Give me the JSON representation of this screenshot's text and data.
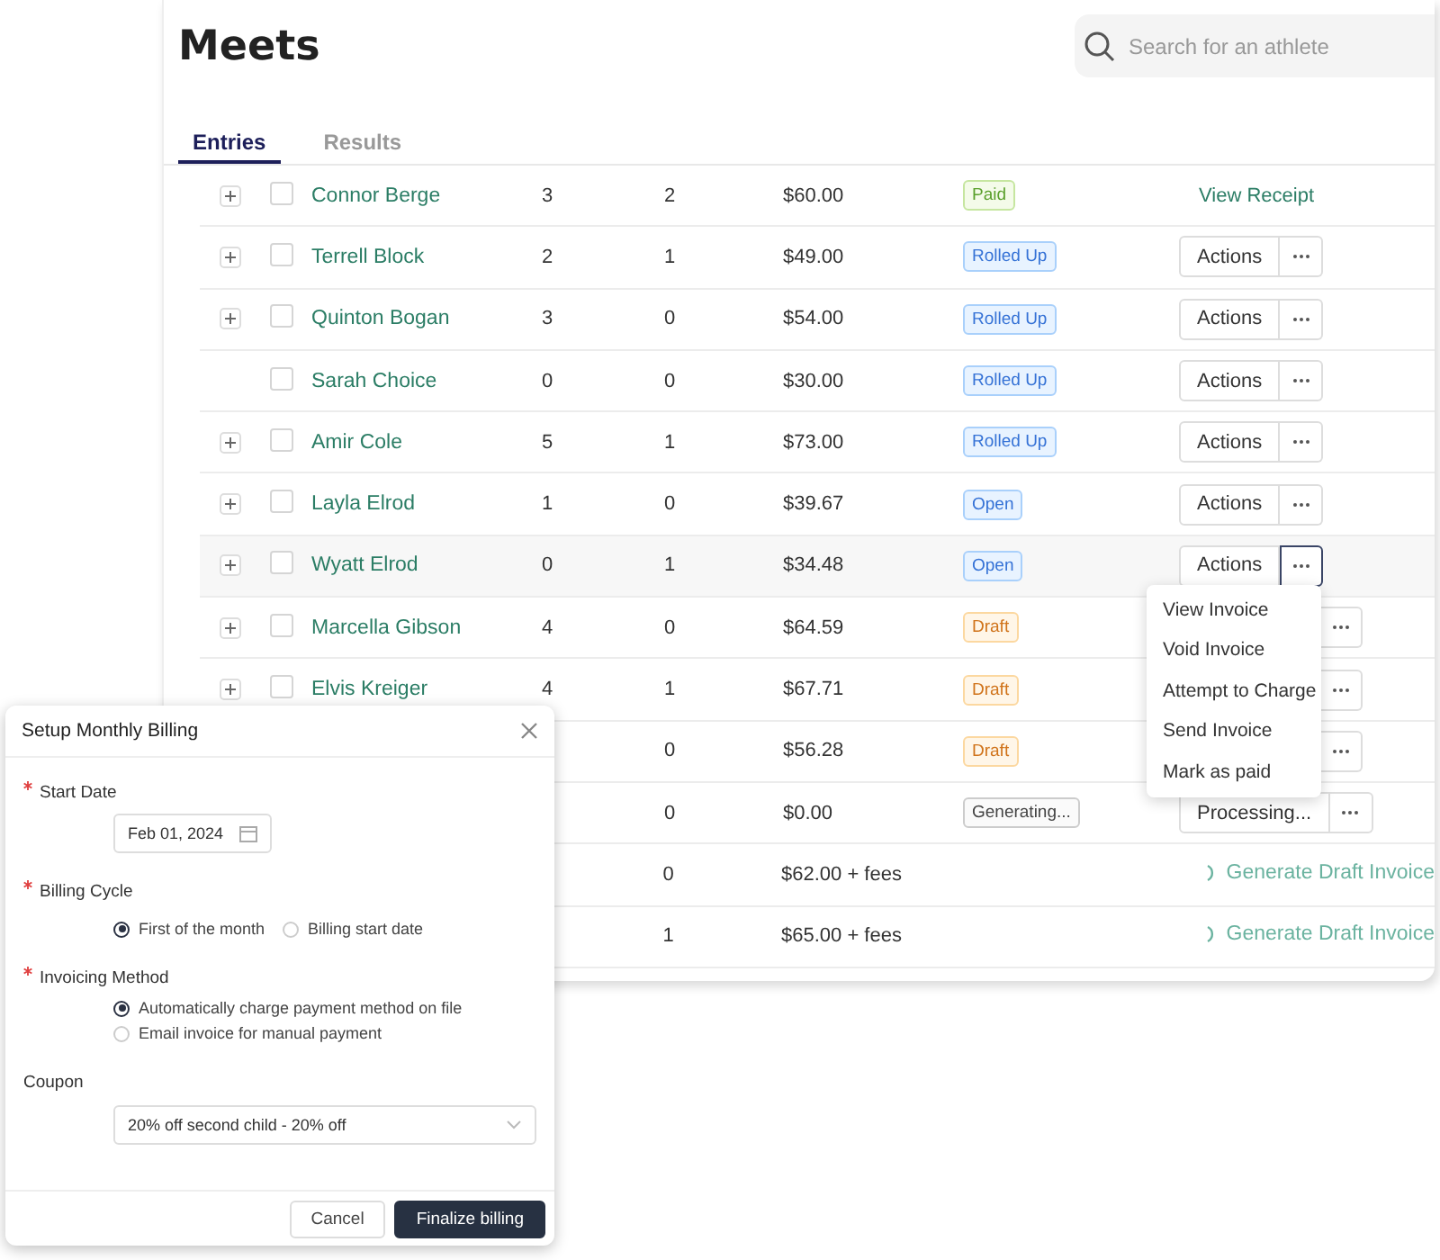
{
  "page": {
    "title": "Meets"
  },
  "search": {
    "placeholder": "Search for an athlete"
  },
  "tabs": [
    {
      "label": "Entries",
      "selected": true
    },
    {
      "label": "Results",
      "selected": false
    }
  ],
  "rows": [
    {
      "expandable": true,
      "checked": false,
      "name": "Connor Berge",
      "column_3": "3",
      "column_4": "2",
      "amount": "$60.00",
      "status": {
        "text": "Paid",
        "kind": "paid"
      },
      "action": {
        "kind": "link",
        "label": "View Receipt"
      }
    },
    {
      "expandable": true,
      "checked": false,
      "name": "Terrell Block",
      "column_3": "2",
      "column_4": "1",
      "amount": "$49.00",
      "status": {
        "text": "Rolled Up",
        "kind": "info"
      },
      "action": {
        "kind": "split",
        "label": "Actions",
        "menu_open": false
      }
    },
    {
      "expandable": true,
      "checked": false,
      "name": "Quinton Bogan",
      "column_3": "3",
      "column_4": "0",
      "amount": "$54.00",
      "status": {
        "text": "Rolled Up",
        "kind": "info"
      },
      "action": {
        "kind": "split",
        "label": "Actions",
        "menu_open": false
      }
    },
    {
      "expandable": false,
      "checked": false,
      "name": "Sarah Choice",
      "column_3": "0",
      "column_4": "0",
      "amount": "$30.00",
      "status": {
        "text": "Rolled Up",
        "kind": "info"
      },
      "action": {
        "kind": "split",
        "label": "Actions",
        "menu_open": false
      }
    },
    {
      "expandable": true,
      "checked": false,
      "name": "Amir Cole",
      "column_3": "5",
      "column_4": "1",
      "amount": "$73.00",
      "status": {
        "text": "Rolled Up",
        "kind": "info"
      },
      "action": {
        "kind": "split",
        "label": "Actions",
        "menu_open": false
      }
    },
    {
      "expandable": true,
      "checked": false,
      "name": "Layla Elrod",
      "column_3": "1",
      "column_4": "0",
      "amount": "$39.67",
      "status": {
        "text": "Open",
        "kind": "info"
      },
      "action": {
        "kind": "split",
        "label": "Actions",
        "menu_open": false
      }
    },
    {
      "expandable": true,
      "checked": false,
      "name": "Wyatt Elrod",
      "column_3": "0",
      "column_4": "1",
      "amount": "$34.48",
      "status": {
        "text": "Open",
        "kind": "info"
      },
      "action": {
        "kind": "split",
        "label": "Actions",
        "menu_open": true
      }
    },
    {
      "expandable": true,
      "checked": false,
      "name": "Marcella Gibson",
      "column_3": "4",
      "column_4": "0",
      "amount": "$64.59",
      "status": {
        "text": "Draft",
        "kind": "draft"
      },
      "action": {
        "kind": "split",
        "menu_open": false
      }
    },
    {
      "expandable": true,
      "checked": false,
      "name": "Elvis Kreiger",
      "column_3": "4",
      "column_4": "1",
      "amount": "$67.71",
      "status": {
        "text": "Draft",
        "kind": "draft"
      },
      "action": {
        "kind": "split",
        "menu_open": false
      }
    },
    {
      "column_4": "0",
      "amount": "$56.28",
      "status": {
        "text": "Draft",
        "kind": "draft"
      },
      "action": {
        "kind": "split",
        "menu_open": false
      }
    },
    {
      "column_4": "0",
      "amount": "$0.00",
      "status": {
        "text": "Generating...",
        "kind": "neutral"
      },
      "action": {
        "kind": "split",
        "label": "Processing...",
        "menu_open": false
      }
    },
    {
      "column_4": "0",
      "amount": "$62.00 + fees",
      "action": {
        "kind": "generate",
        "label": "Generate Draft Invoice"
      }
    },
    {
      "column_4": "1",
      "amount": "$65.00 + fees",
      "action": {
        "kind": "generate",
        "label": "Generate Draft Invoice"
      }
    }
  ],
  "action_menu": {
    "items": [
      "View Invoice",
      "Void Invoice",
      "Attempt to Charge",
      "Send Invoice",
      "Mark as paid"
    ]
  },
  "modal": {
    "title": "Setup Monthly Billing",
    "start_date": {
      "label": "Start Date",
      "required": true,
      "value": "Feb 01, 2024"
    },
    "billing_cycle": {
      "label": "Billing Cycle",
      "required": true,
      "options": [
        {
          "label": "First of the month",
          "selected": true
        },
        {
          "label": "Billing start date",
          "selected": false
        }
      ]
    },
    "invoicing_method": {
      "label": "Invoicing Method",
      "required": true,
      "options": [
        {
          "label": "Automatically charge payment method on file",
          "selected": true
        },
        {
          "label": "Email invoice for manual payment",
          "selected": false
        }
      ]
    },
    "coupon": {
      "label": "Coupon",
      "required": false,
      "value": "20% off second child - 20% off"
    },
    "buttons": [
      {
        "label": "Cancel",
        "kind": "secondary"
      },
      {
        "label": "Finalize billing",
        "kind": "primary"
      }
    ]
  }
}
